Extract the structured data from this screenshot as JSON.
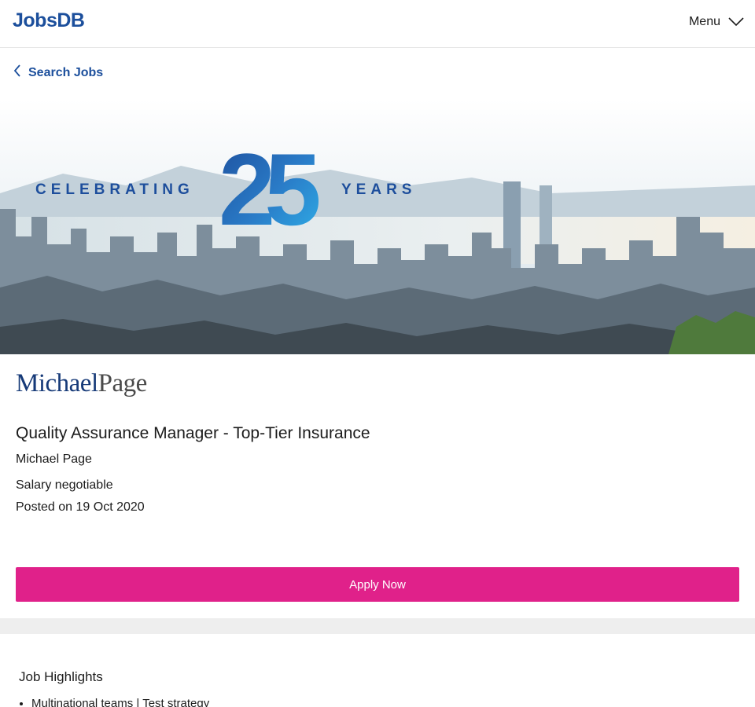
{
  "header": {
    "logo": "JobsDB",
    "menu_label": "Menu"
  },
  "breadcrumb": {
    "back_label": "Search Jobs"
  },
  "banner": {
    "text_left": "CELEBRATING",
    "number": "25",
    "text_right": "YEARS"
  },
  "job": {
    "company_logo_part1": "Michael",
    "company_logo_part2": "Page",
    "title": "Quality Assurance Manager - Top-Tier Insurance",
    "company": "Michael Page",
    "salary": "Salary negotiable",
    "posted": "Posted on 19 Oct 2020",
    "apply_label": "Apply Now"
  },
  "highlights": {
    "title": "Job Highlights",
    "items": [
      "Multinational teams | Test strategy"
    ]
  },
  "colors": {
    "brand_blue": "#1c4f9c",
    "apply_pink": "#e0218a",
    "divider_gray": "#eeeeee"
  }
}
